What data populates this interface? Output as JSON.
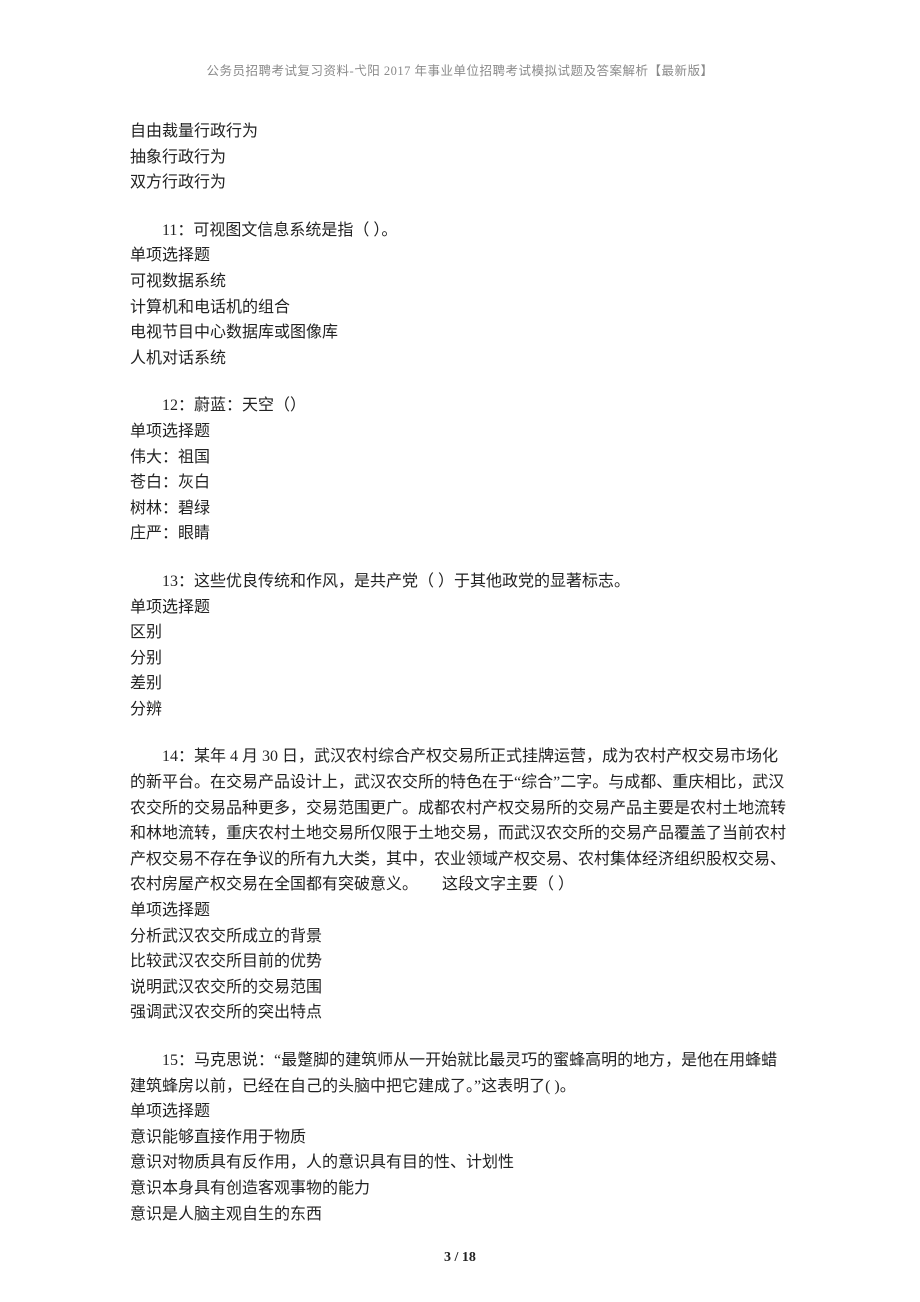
{
  "header": "公务员招聘考试复习资料-弋阳 2017 年事业单位招聘考试模拟试题及答案解析【最新版】",
  "orphan": {
    "options": [
      "自由裁量行政行为",
      "抽象行政行为",
      "双方行政行为"
    ]
  },
  "questions": [
    {
      "stem": "11：可视图文信息系统是指（  ）。",
      "type": "单项选择题",
      "options": [
        "可视数据系统",
        "计算机和电话机的组合",
        "电视节目中心数据库或图像库",
        "人机对话系统"
      ]
    },
    {
      "stem": "12：蔚蓝：天空（）",
      "type": "单项选择题",
      "options": [
        "伟大：祖国",
        "苍白：灰白",
        "树林：碧绿",
        "庄严：眼睛"
      ]
    },
    {
      "stem": "13：这些优良传统和作风，是共产党（  ）于其他政党的显著标志。",
      "type": "单项选择题",
      "options": [
        "区别",
        "分别",
        "差别",
        "分辨"
      ]
    },
    {
      "stem": "14：某年 4 月 30 日，武汉农村综合产权交易所正式挂牌运营，成为农村产权交易市场化的新平台。在交易产品设计上，武汉农交所的特色在于“综合”二字。与成都、重庆相比，武汉农交所的交易品种更多，交易范围更广。成都农村产权交易所的交易产品主要是农村土地流转和林地流转，重庆农村土地交易所仅限于土地交易，而武汉农交所的交易产品覆盖了当前农村产权交易不存在争议的所有九大类，其中，农业领域产权交易、农村集体经济组织股权交易、农村房屋产权交易在全国都有突破意义。　　这段文字主要（  ）",
      "type": "单项选择题",
      "options": [
        "分析武汉农交所成立的背景",
        "比较武汉农交所目前的优势",
        "说明武汉农交所的交易范围",
        "强调武汉农交所的突出特点"
      ]
    },
    {
      "stem": "15：马克思说：“最蹩脚的建筑师从一开始就比最灵巧的蜜蜂高明的地方，是他在用蜂蜡建筑蜂房以前，已经在自己的头脑中把它建成了。”这表明了( )。",
      "type": "单项选择题",
      "options": [
        "意识能够直接作用于物质",
        "意识对物质具有反作用，人的意识具有目的性、计划性",
        "意识本身具有创造客观事物的能力",
        "意识是人脑主观自生的东西"
      ]
    }
  ],
  "footer": "3 / 18"
}
